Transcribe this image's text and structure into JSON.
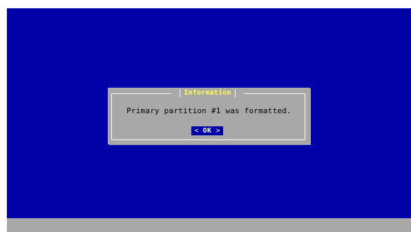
{
  "dialog": {
    "title": "Information",
    "message": "Primary partition #1 was formatted.",
    "button": {
      "left_bracket": "<",
      "label": "OK",
      "right_bracket": ">"
    }
  },
  "colors": {
    "desktop_bg": "#0000a8",
    "dialog_bg": "#a8a8a8",
    "title_text": "#ffff54",
    "frame": "#ffffff",
    "button_bg": "#0000a8",
    "button_text": "#ffffff",
    "bottom_bar": "#a8a8a8"
  },
  "icons": {
    "title_separators": "box-drawing-tick"
  }
}
